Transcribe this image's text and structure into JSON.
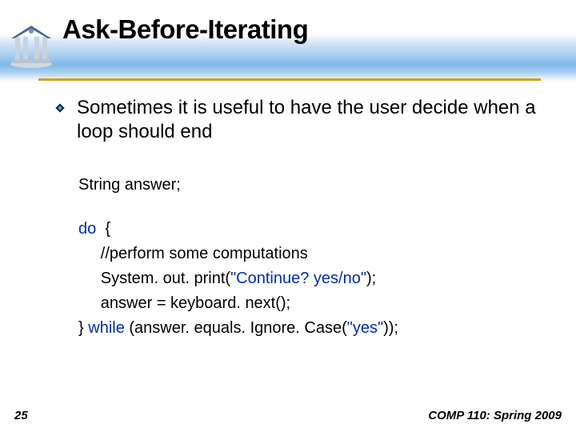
{
  "title": "Ask-Before-Iterating",
  "bullet": "Sometimes it is useful to have the user decide when a loop should end",
  "code": {
    "l1": "String answer;",
    "l2a": "do",
    "l2b": "  {",
    "l3": "     //perform some computations",
    "l4a": "     System. out. print(",
    "l4b": "\"Continue? yes/no\"",
    "l4c": ");",
    "l5": "     answer = keyboard. next();",
    "l6a": "} ",
    "l6b": "while",
    "l6c": " (answer. equals. Ignore. Case(",
    "l6d": "\"yes\"",
    "l6e": "));"
  },
  "page_num": "25",
  "footer": "COMP 110: Spring 2009"
}
